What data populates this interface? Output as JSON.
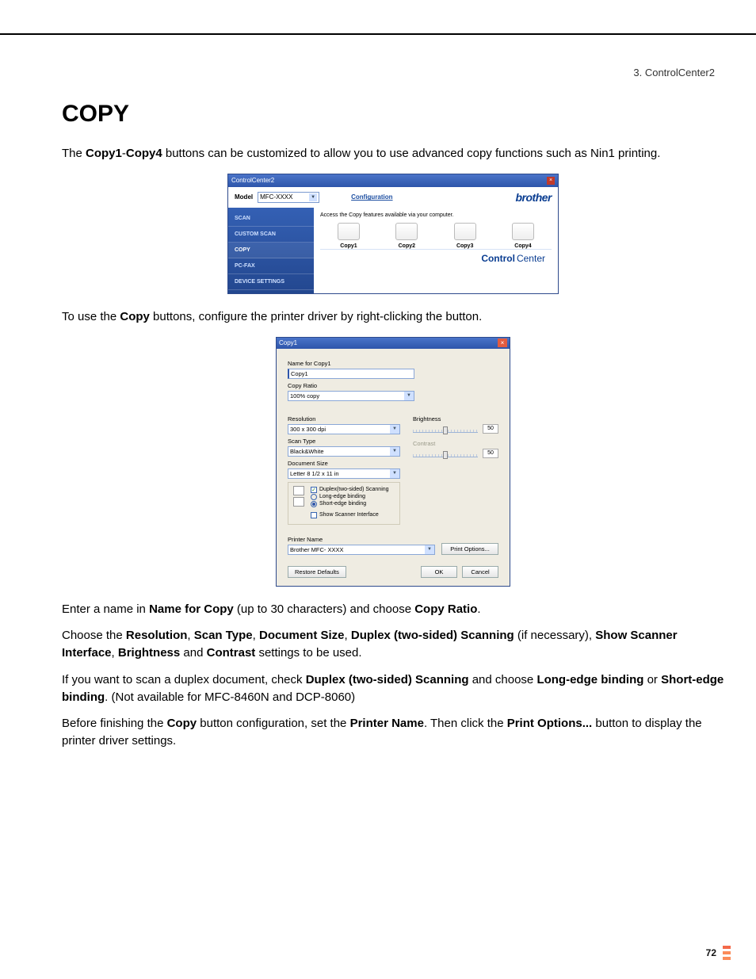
{
  "breadcrumb": "3. ControlCenter2",
  "heading": "COPY",
  "intro": {
    "pre": "The ",
    "b1": "Copy1",
    "dash": "-",
    "b2": "Copy4",
    "post": " buttons can be customized to allow you to use advanced copy functions such as Nin1 printing."
  },
  "cc": {
    "title": "ControlCenter2",
    "model_label": "Model",
    "model_value": "MFC-XXXX",
    "config": "Configuration",
    "brand": "brother",
    "sidebar": [
      "SCAN",
      "CUSTOM SCAN",
      "COPY",
      "PC-FAX",
      "DEVICE SETTINGS"
    ],
    "desc": "Access the Copy features available via your computer.",
    "buttons": [
      "Copy1",
      "Copy2",
      "Copy3",
      "Copy4"
    ],
    "footer_control": "Control",
    "footer_center": "Center"
  },
  "mid": {
    "pre": "To use the ",
    "b": "Copy",
    "post": " buttons, configure the printer driver by right-clicking the button."
  },
  "dlg": {
    "title": "Copy1",
    "name_label": "Name for Copy1",
    "name_value": "Copy1",
    "ratio_label": "Copy Ratio",
    "ratio_value": "100% copy",
    "res_label": "Resolution",
    "res_value": "300 x 300 dpi",
    "scan_label": "Scan Type",
    "scan_value": "Black&White",
    "doc_label": "Document Size",
    "doc_value": "Letter 8 1/2 x 11 in",
    "duplex_label": "Duplex(two-sided) Scanning",
    "long_edge": "Long-edge binding",
    "short_edge": "Short-edge binding",
    "show_scanner": "Show Scanner Interface",
    "brightness_label": "Brightness",
    "brightness_value": "50",
    "contrast_label": "Contrast",
    "contrast_value": "50",
    "printer_label": "Printer Name",
    "printer_value": "Brother MFC- XXXX",
    "print_options": "Print Options...",
    "restore": "Restore Defaults",
    "ok": "OK",
    "cancel": "Cancel"
  },
  "p1": {
    "pre": "Enter a name in ",
    "b1": "Name for Copy",
    "mid": " (up to 30 characters) and choose ",
    "b2": "Copy Ratio",
    "post": "."
  },
  "p2": {
    "pre": "Choose the ",
    "b1": "Resolution",
    "s1": ", ",
    "b2": "Scan Type",
    "s2": ", ",
    "b3": "Document Size",
    "s3": ", ",
    "b4": "Duplex (two-sided) Scanning",
    "s4": " (if necessary), ",
    "b5": "Show Scanner Interface",
    "s5": ", ",
    "b6": "Brightness",
    "s6": " and ",
    "b7": "Contrast",
    "post": " settings to be used."
  },
  "p3": {
    "pre": "If you want to scan a duplex document, check ",
    "b1": "Duplex (two-sided) Scanning",
    "s1": " and choose ",
    "b2": "Long-edge binding",
    "s2": " or ",
    "b3": "Short-edge binding",
    "post": ". (Not available for MFC-8460N and DCP-8060)"
  },
  "p4": {
    "pre": "Before finishing the ",
    "b1": "Copy",
    "s1": " button configuration, set the ",
    "b2": "Printer Name",
    "s2": ". Then click the ",
    "b3": "Print Options...",
    "post": " button to display the printer driver settings."
  },
  "page_number": "72"
}
